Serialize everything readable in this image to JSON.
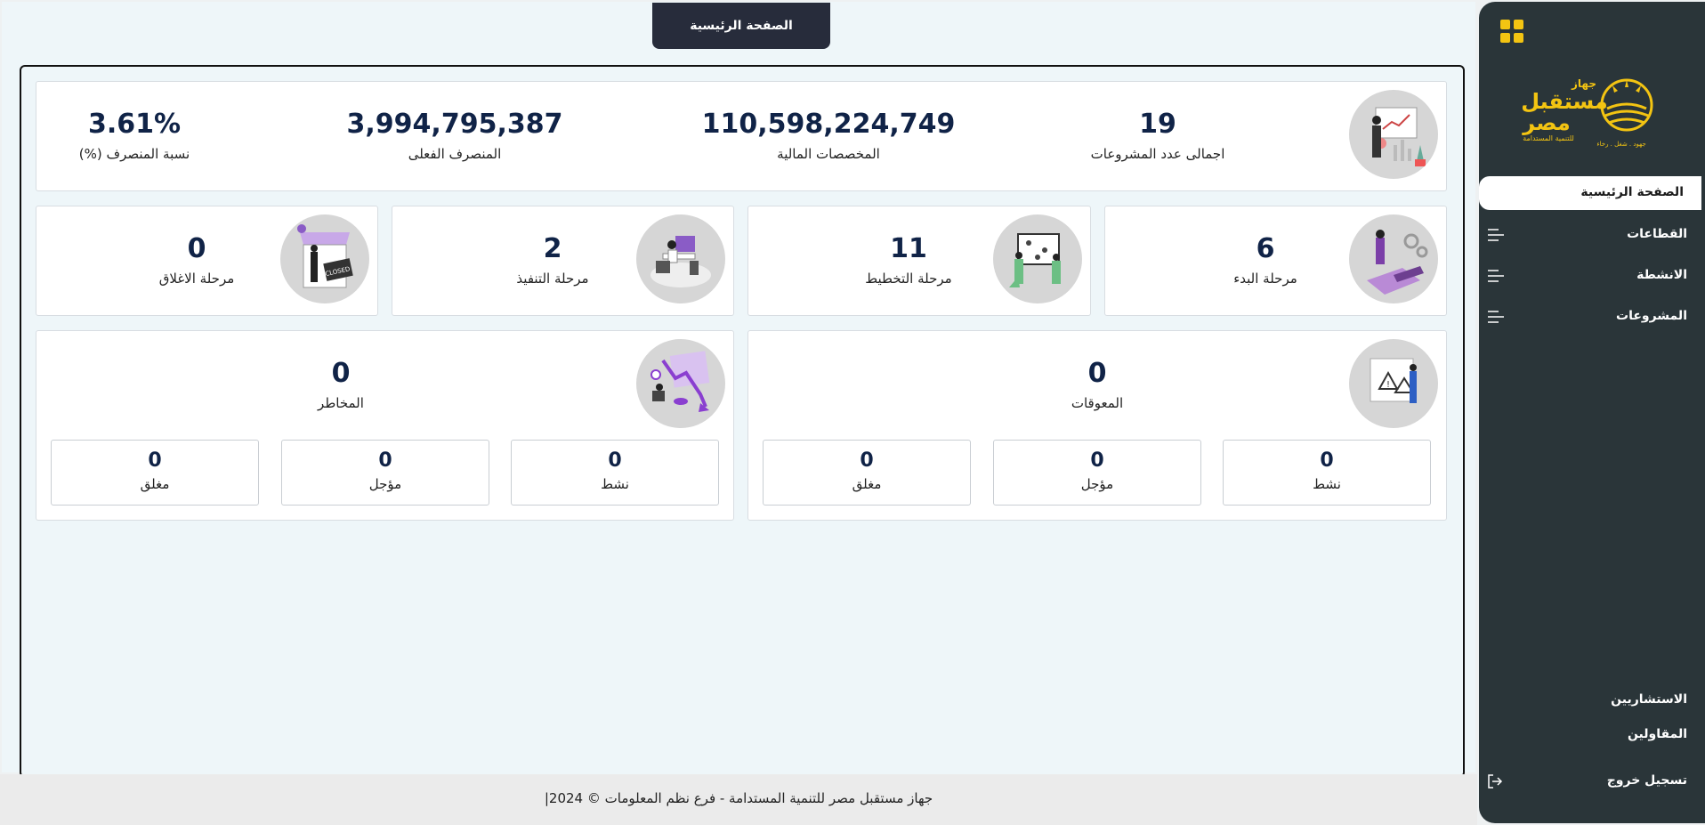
{
  "header": {
    "tab_label": "الصفحة الرئيسية"
  },
  "sidebar": {
    "brand": {
      "line1": "جهاز",
      "line2": "مستقبل",
      "line3": "مصر",
      "tagline": "للتنمية المستدامة",
      "slogan": "جهود . شغل . رخاء"
    },
    "home_label": "الصفحة الرئيسية",
    "items": [
      {
        "label": "القطاعات"
      },
      {
        "label": "الانشطة"
      },
      {
        "label": "المشروعات"
      }
    ],
    "consultants_label": "الاستشاريين",
    "contractors_label": "المقاولين",
    "logout_label": "تسجيل خروج",
    "accent_color": "#f3c412"
  },
  "summary": {
    "total_projects": {
      "value": "19",
      "label": "اجمالى عدد المشروعات"
    },
    "allocations": {
      "value": "110,598,224,749",
      "label": "المخصصات المالية"
    },
    "actual_spent": {
      "value": "3,994,795,387",
      "label": "المنصرف الفعلى"
    },
    "spent_ratio": {
      "value": "3.61%",
      "label": "نسبة المنصرف (%)"
    }
  },
  "phases": [
    {
      "value": "6",
      "label": "مرحلة البدء"
    },
    {
      "value": "11",
      "label": "مرحلة التخطيط"
    },
    {
      "value": "2",
      "label": "مرحلة التنفيذ"
    },
    {
      "value": "0",
      "label": "مرحلة الاغلاق"
    }
  ],
  "obstacles": {
    "value": "0",
    "label": "المعوقات",
    "subs": [
      {
        "value": "0",
        "label": "نشط"
      },
      {
        "value": "0",
        "label": "مؤجل"
      },
      {
        "value": "0",
        "label": "مغلق"
      }
    ]
  },
  "risks": {
    "value": "0",
    "label": "المخاطر",
    "subs": [
      {
        "value": "0",
        "label": "نشط"
      },
      {
        "value": "0",
        "label": "مؤجل"
      },
      {
        "value": "0",
        "label": "مغلق"
      }
    ]
  },
  "closed_sign_text": "CLOSED",
  "footer": {
    "text": "جهاز مستقبل مصر للتنمية المستدامة - فرع نظم المعلومات © 2024|"
  }
}
